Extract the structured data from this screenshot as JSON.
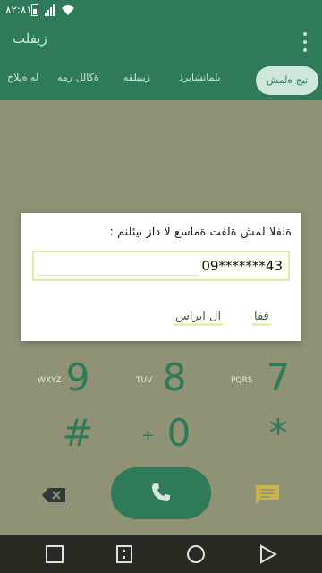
{
  "status_bar": {
    "time": "٨٢:٨١"
  },
  "app_bar": {
    "title": "زيفلت",
    "overflow_icon": "more-vert-icon"
  },
  "tabs": [
    {
      "label": "تيج ەلمش",
      "active": true
    },
    {
      "label": "ىلماتشايرذ"
    },
    {
      "label": "زيبيلقه"
    },
    {
      "label": "ةكالل رمه"
    },
    {
      "label": "له ەيلاخ"
    }
  ],
  "dialog": {
    "message": "ةلفلا لمش ةلفت ةماسع لا داز ىيئلنم :",
    "input_value": "09*******43",
    "ok_label": "قفا",
    "cancel_label": "ال ايراس"
  },
  "dialpad": {
    "rows": [
      [
        {
          "digit": "9",
          "letters": "WXYZ"
        },
        {
          "digit": "8",
          "letters": "TUV"
        },
        {
          "digit": "7",
          "letters": "PQRS"
        }
      ],
      [
        {
          "digit": "#",
          "letters": ""
        },
        {
          "digit": "0",
          "letters": "+"
        },
        {
          "digit": "*",
          "letters": ""
        }
      ]
    ]
  },
  "colors": {
    "primary": "#2e7a59",
    "dim_overlay": "#8f9275",
    "nav_bar": "#2a2a22",
    "tab_active_bg": "#cfe6da"
  }
}
